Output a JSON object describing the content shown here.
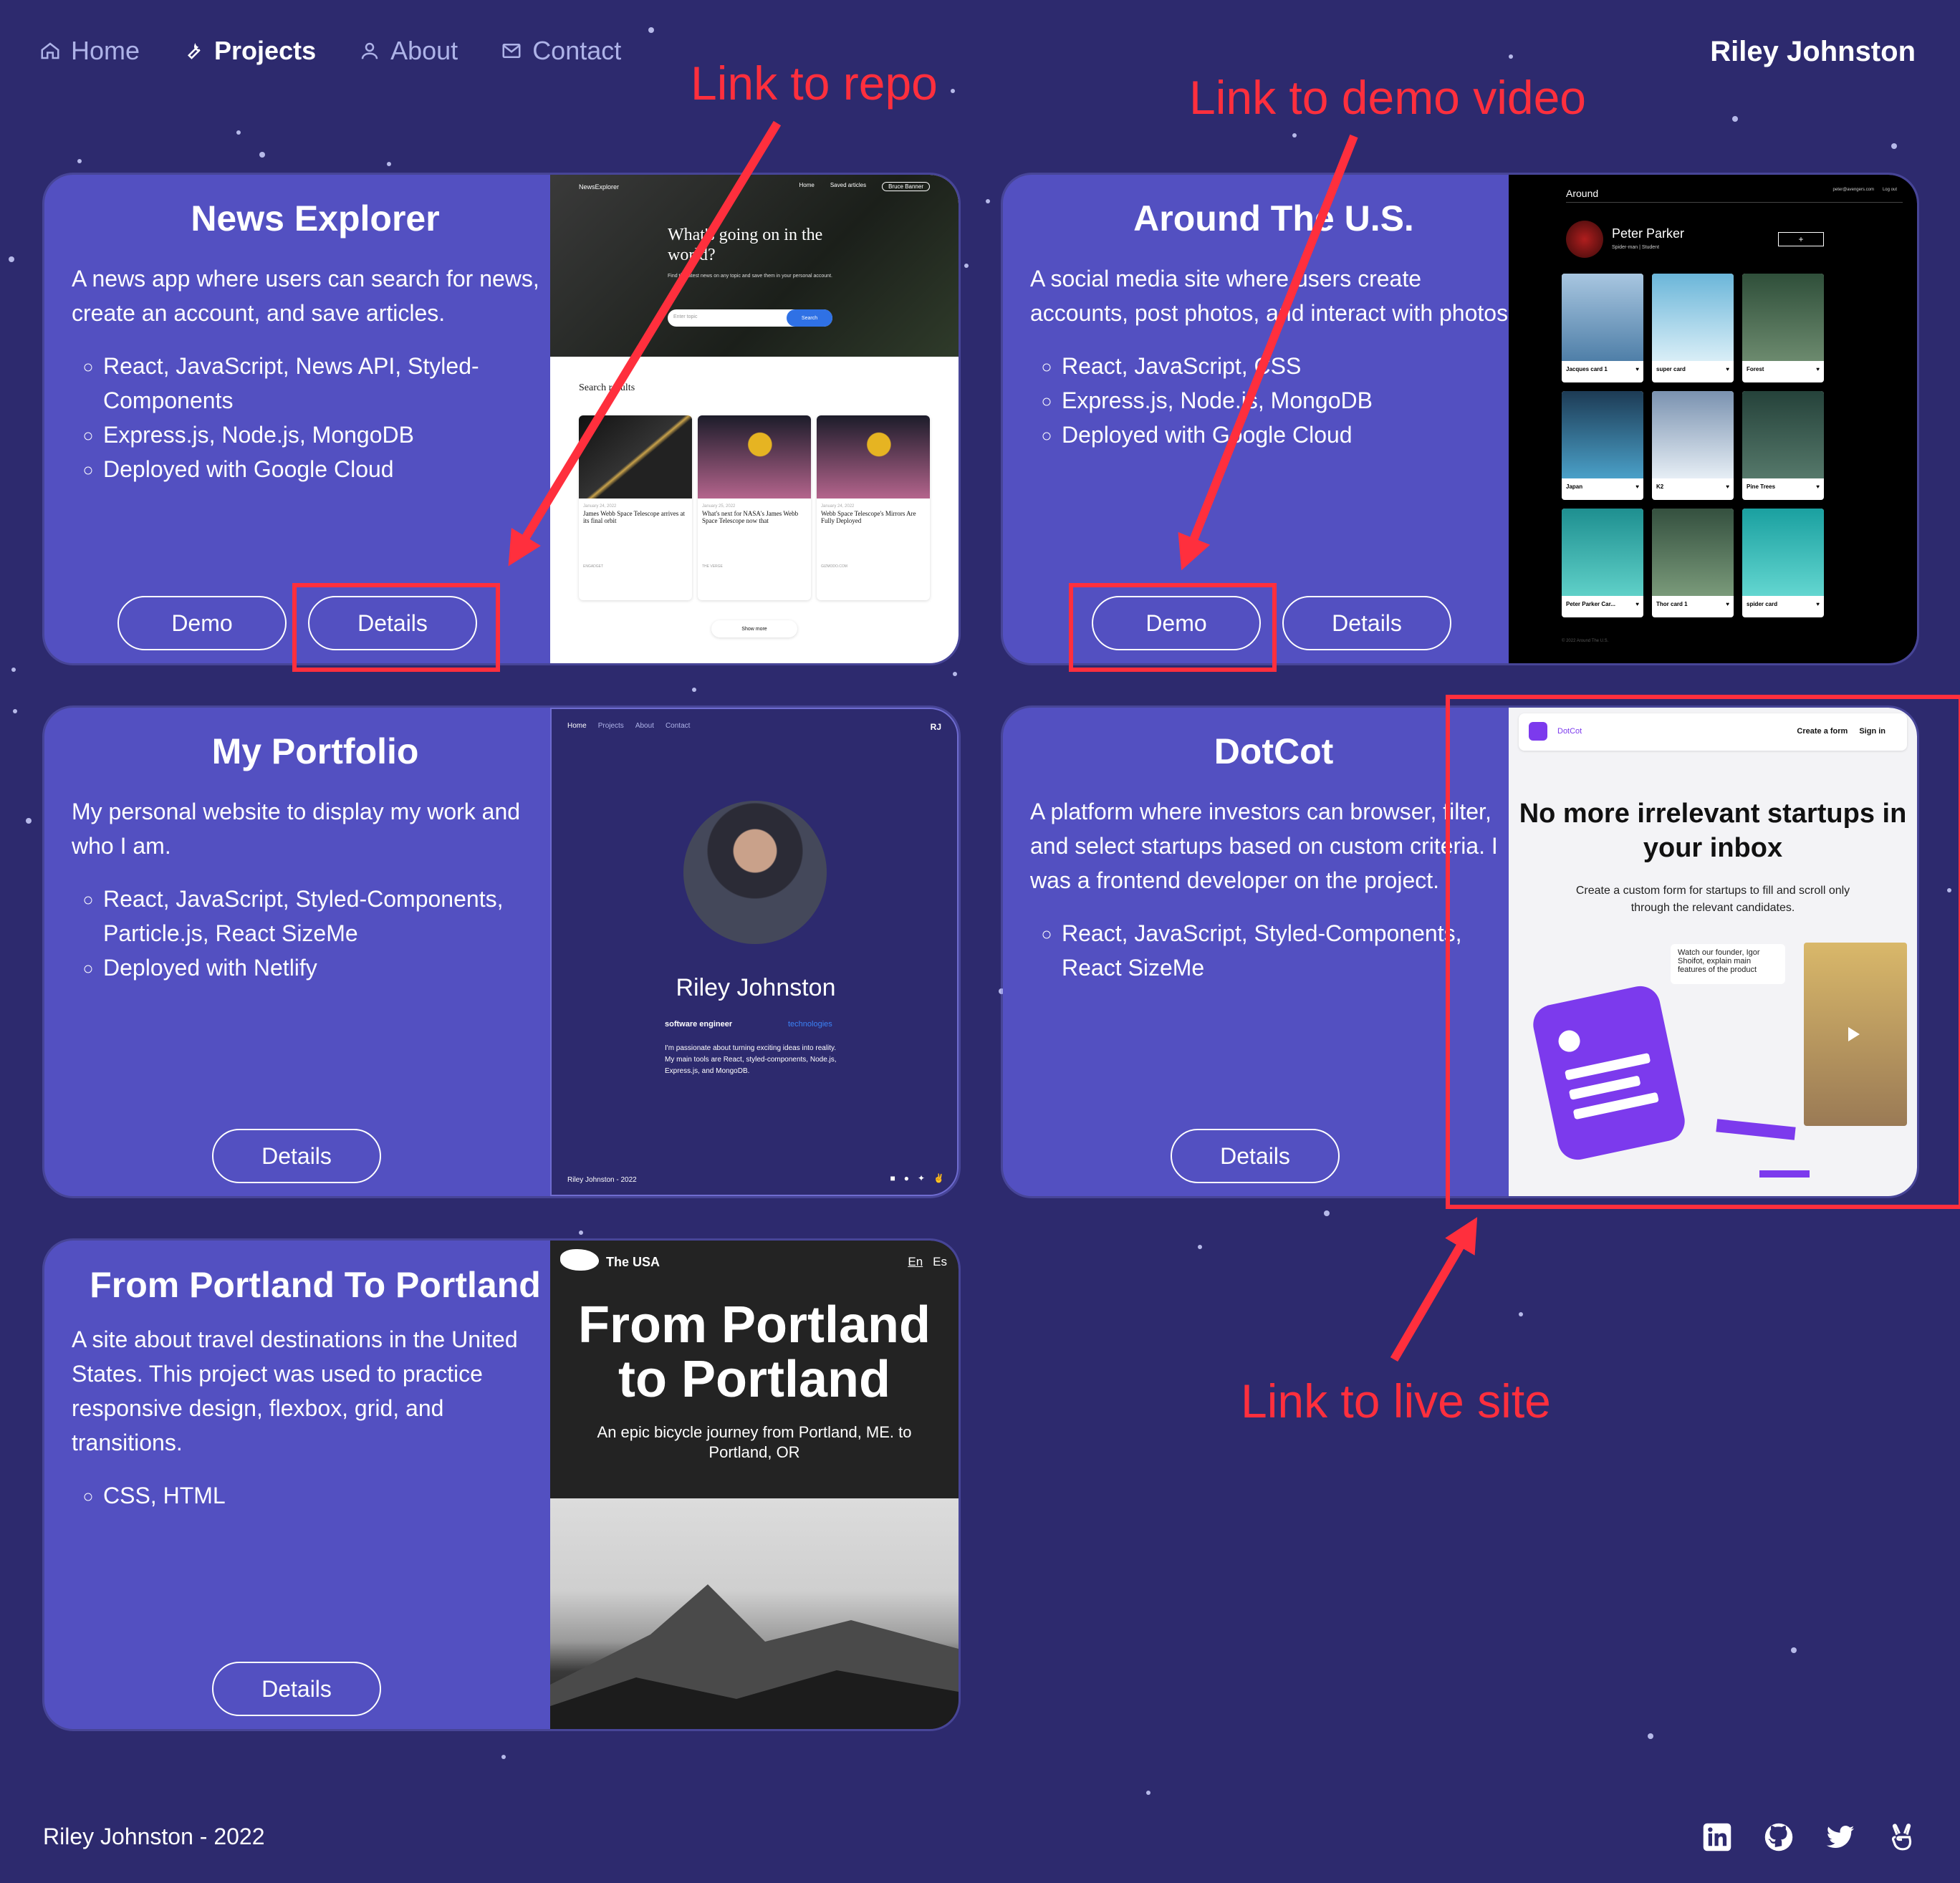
{
  "nav": {
    "items": [
      {
        "label": "Home",
        "icon": "home-icon"
      },
      {
        "label": "Projects",
        "icon": "wrench-icon"
      },
      {
        "label": "About",
        "icon": "user-icon"
      },
      {
        "label": "Contact",
        "icon": "mail-icon"
      }
    ],
    "brand": "Riley Johnston"
  },
  "projects": [
    {
      "title": "News Explorer",
      "description": "A news app where users can search for news, create an account, and save articles.",
      "tech": [
        "React, JavaScript, News API, Styled-Components",
        "Express.js, Node.js, MongoDB",
        "Deployed with Google Cloud"
      ],
      "buttons": [
        "Demo",
        "Details"
      ],
      "screenshot": {
        "logo": "NewsExplorer",
        "nav": [
          "Home",
          "Saved articles",
          "Bruce Banner"
        ],
        "headline": "What's going on in the world?",
        "subline": "Find the latest news on any topic and save them in your personal account.",
        "search_placeholder": "Enter topic",
        "search_button": "Search",
        "results_title": "Search results",
        "articles": [
          {
            "date": "January 24, 2022",
            "title": "James Webb Space Telescope arrives at its final orbit",
            "source": "ENGADGET"
          },
          {
            "date": "January 25, 2022",
            "title": "What's next for NASA's James Webb Space Telescope now that",
            "source": "THE VERGE"
          },
          {
            "date": "January 24, 2022",
            "title": "Webb Space Telescope's Mirrors Are Fully Deployed",
            "source": "GIZMODO.COM"
          }
        ],
        "show_more": "Show more"
      }
    },
    {
      "title": "Around The U.S.",
      "description": "A social media site where users create accounts, post photos, and interact with photos.",
      "tech": [
        "React, JavaScript, CSS",
        "Express.js, Node.js, MongoDB",
        "Deployed with Google Cloud"
      ],
      "buttons": [
        "Demo",
        "Details"
      ],
      "screenshot": {
        "logo": "Around",
        "email": "peter@avengers.com",
        "logout": "Log out",
        "profile_name": "Peter Parker",
        "profile_about": "Spider-man | Student",
        "add_label": "+",
        "cards": [
          "Jacques card 1",
          "super card",
          "Forest",
          "Japan",
          "K2",
          "Pine Trees",
          "Peter Parker Car...",
          "Thor card 1",
          "spider card"
        ],
        "footer": "© 2022 Around The U.S."
      }
    },
    {
      "title": "My Portfolio",
      "description": "My personal website to display my work and who I am.",
      "tech": [
        "React, JavaScript, Styled-Components, Particle.js, React SizeMe",
        "Deployed with Netlify"
      ],
      "buttons": [
        "Details"
      ],
      "screenshot": {
        "nav": [
          "Home",
          "Projects",
          "About",
          "Contact"
        ],
        "initials": "RJ",
        "name": "Riley Johnston",
        "role": "software engineer",
        "link": "technologies",
        "bio": "I'm passionate about turning exciting ideas into reality. My main tools are React, styled-components, Node.js, Express.js, and MongoDB.",
        "footer": "Riley Johnston - 2022"
      }
    },
    {
      "title": "DotCot",
      "description": "A platform where investors can browser, filter, and select startups based on custom criteria. I was a frontend developer on the project.",
      "tech": [
        "React, JavaScript, Styled-Components, React SizeMe"
      ],
      "buttons": [
        "Details"
      ],
      "screenshot": {
        "logo": "DotCot",
        "nav": [
          "Create a form",
          "Sign in"
        ],
        "headline": "No more irrelevant startups in your inbox",
        "subline": "Create a custom form for startups to fill and scroll only through the relevant candidates.",
        "video_note": "Watch our founder, Igor Shoifot, explain main features of the product"
      }
    },
    {
      "title": "From Portland To Portland",
      "description": "A site about travel destinations in the United States. This project was used to practice responsive design, flexbox, grid, and transitions.",
      "tech": [
        "CSS, HTML"
      ],
      "buttons": [
        "Details"
      ],
      "screenshot": {
        "logo": "The USA",
        "lang": [
          "En",
          "Es"
        ],
        "headline": "From Portland to Portland",
        "subline": "An epic bicycle journey from Portland, ME. to Portland, OR"
      }
    }
  ],
  "annotations": [
    "Link to repo",
    "Link to demo video",
    "Link to live site"
  ],
  "footer": {
    "copyright": "Riley Johnston - 2022",
    "socials": [
      "linkedin-icon",
      "github-icon",
      "twitter-icon",
      "angellist-icon"
    ]
  },
  "colors": {
    "background": "#2d2a6e",
    "card": "#5350c1",
    "annotation": "#ff2f3d",
    "accent": "#7c3aed"
  }
}
